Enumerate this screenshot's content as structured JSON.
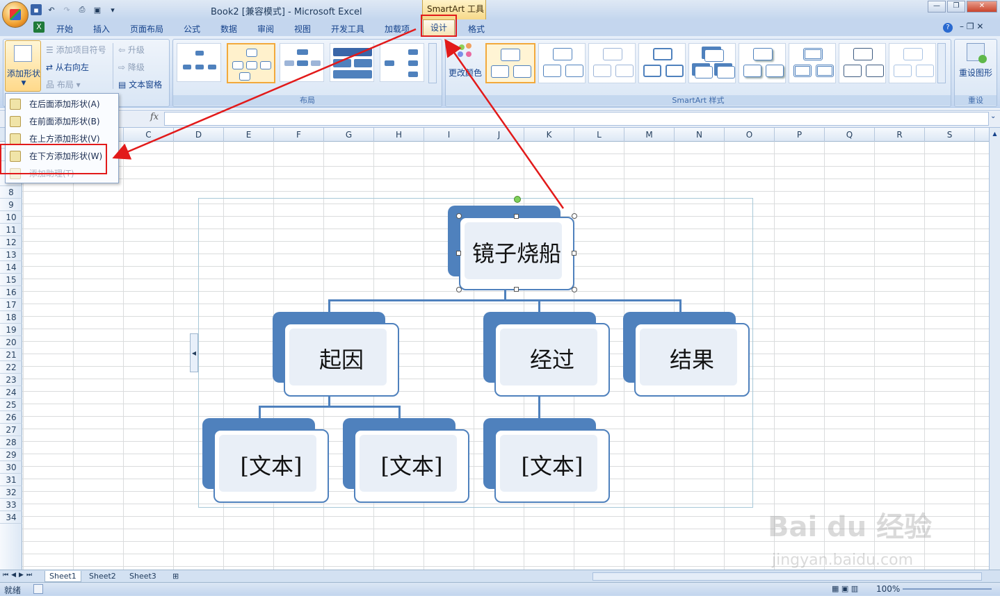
{
  "title": {
    "window_title": "Book2  [兼容模式] - Microsoft Excel",
    "context_tool": "SmartArt 工具"
  },
  "tabs": [
    "开始",
    "插入",
    "页面布局",
    "公式",
    "数据",
    "审阅",
    "视图",
    "开发工具",
    "加载项",
    "设计",
    "格式"
  ],
  "ribbon": {
    "add_shape": "添加形状",
    "add_bullet": "添加项目符号",
    "right_to_left": "从右向左",
    "layout_btn": "布局",
    "promote": "升级",
    "demote": "降级",
    "text_pane": "文本窗格",
    "group_layout": "布局",
    "change_colors": "更改颜色",
    "group_styles": "SmartArt 样式",
    "reset_graphic": "重设图形",
    "group_reset": "重设"
  },
  "dropdown": [
    {
      "label": "在后面添加形状(A)",
      "enabled": true
    },
    {
      "label": "在前面添加形状(B)",
      "enabled": true
    },
    {
      "label": "在上方添加形状(V)",
      "enabled": true
    },
    {
      "label": "在下方添加形状(W)",
      "enabled": true
    },
    {
      "label": "添加助理(T)",
      "enabled": false
    }
  ],
  "formula": {
    "fx": "fx",
    "value": ""
  },
  "columns": [
    "C",
    "D",
    "E",
    "F",
    "G",
    "H",
    "I",
    "J",
    "K",
    "L",
    "M",
    "N",
    "O",
    "P",
    "Q",
    "R",
    "S"
  ],
  "rows": [
    "4",
    "5",
    "6",
    "7",
    "8",
    "9",
    "10",
    "11",
    "12",
    "13",
    "14",
    "15",
    "16",
    "17",
    "18",
    "19",
    "20",
    "21",
    "22",
    "23",
    "24",
    "25",
    "26",
    "27",
    "28",
    "29",
    "30",
    "31",
    "32",
    "33",
    "34"
  ],
  "smartart": {
    "root": "镜子烧船",
    "level2": [
      "起因",
      "经过",
      "结果"
    ],
    "level3": [
      "[文本]",
      "[文本]",
      "[文本]"
    ]
  },
  "sheets": [
    "Sheet1",
    "Sheet2",
    "Sheet3"
  ],
  "status": {
    "ready": "就绪",
    "zoom": "100%"
  },
  "colors": {
    "accent": "#4f81bd",
    "highlight": "#e21a1a",
    "ribbon": "#c4d6ee"
  },
  "watermark": {
    "brand": "Bai du 经验",
    "url": "jingyan.baidu.com"
  }
}
